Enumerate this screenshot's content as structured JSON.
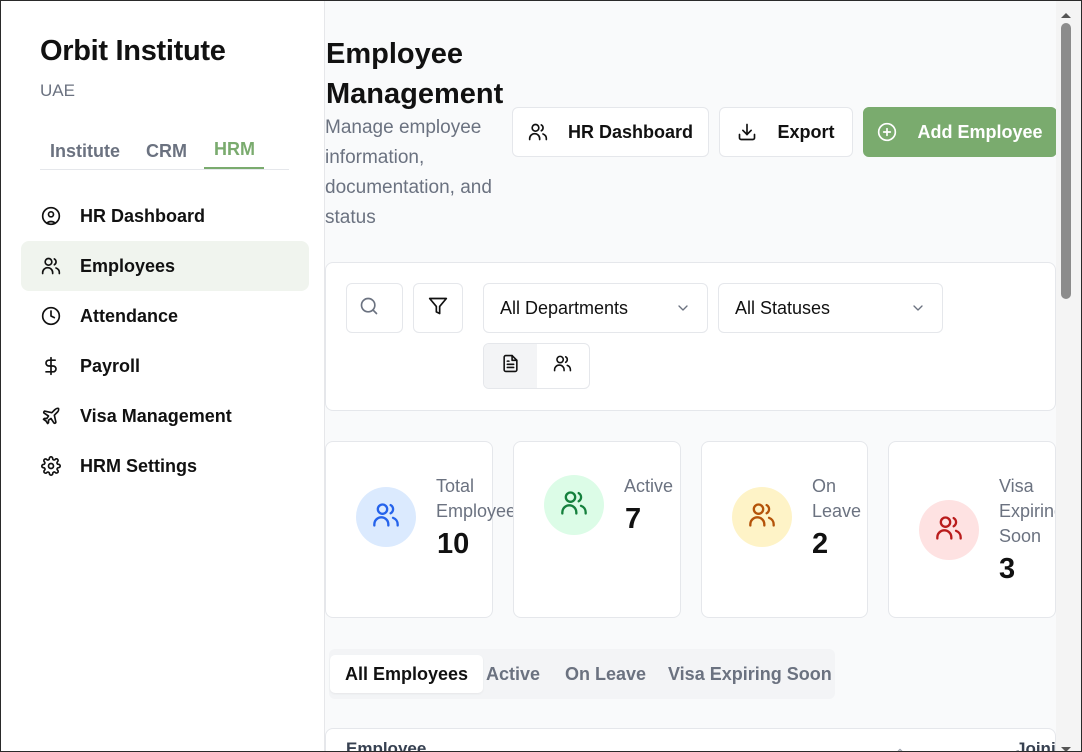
{
  "sidebar": {
    "brand": "Orbit Institute",
    "subtitle": "UAE",
    "module_tabs": [
      "Institute",
      "CRM",
      "HRM"
    ],
    "active_module": "HRM",
    "nav": [
      {
        "label": "HR Dashboard",
        "icon": "user-circle-icon"
      },
      {
        "label": "Employees",
        "icon": "users-icon",
        "active": true
      },
      {
        "label": "Attendance",
        "icon": "clock-icon"
      },
      {
        "label": "Payroll",
        "icon": "dollar-icon"
      },
      {
        "label": "Visa Management",
        "icon": "plane-icon"
      },
      {
        "label": "HRM Settings",
        "icon": "gear-icon"
      }
    ]
  },
  "header": {
    "title": "Employee Management",
    "subtitle": "Manage employee information, documentation, and status",
    "buttons": {
      "hr_dashboard": "HR Dashboard",
      "export": "Export",
      "add_employee": "Add Employee"
    }
  },
  "filters": {
    "department": "All Departments",
    "status": "All Statuses"
  },
  "stats": [
    {
      "label": "Total Employees",
      "value": "10",
      "color": "#dbeafe",
      "icon_color": "#2563eb"
    },
    {
      "label": "Active",
      "value": "7",
      "color": "#dcfce7",
      "icon_color": "#15803d"
    },
    {
      "label": "On Leave",
      "value": "2",
      "color": "#fef3c7",
      "icon_color": "#b45309"
    },
    {
      "label": "Visa Expiring Soon",
      "value": "3",
      "color": "#fee2e2",
      "icon_color": "#b91c1c"
    }
  ],
  "tabs": [
    "All Employees",
    "Active",
    "On Leave",
    "Visa Expiring Soon"
  ],
  "table": {
    "headers": [
      "Employee",
      "Joini"
    ]
  },
  "colors": {
    "accent": "#7aab6e"
  }
}
